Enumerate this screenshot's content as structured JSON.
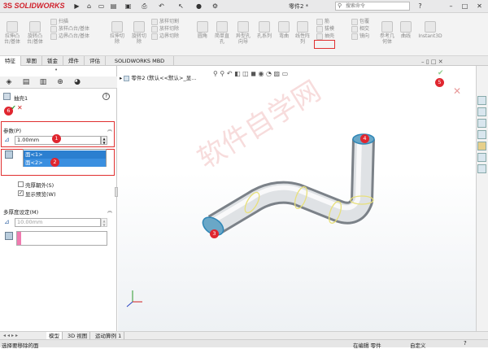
{
  "app": {
    "brand": "SOLIDWORKS",
    "brand_prefix": "3S",
    "doc_title": "零件2 *",
    "search_placeholder": "搜索命令"
  },
  "ribbon": {
    "large": [
      {
        "label": "拉伸凸\n台/基体"
      },
      {
        "label": "旋转凸\n台/基体"
      },
      {
        "label": "拉伸切\n除"
      },
      {
        "label": "旋转切\n除"
      },
      {
        "label": "圆角"
      },
      {
        "label": "简单直\n孔"
      },
      {
        "label": "异型孔\n向导"
      },
      {
        "label": "孔系列"
      },
      {
        "label": "弯曲"
      },
      {
        "label": "线性阵\n列"
      },
      {
        "label": "参考几\n何体"
      },
      {
        "label": "曲线"
      },
      {
        "label": "Instant3D"
      }
    ],
    "small": [
      "扫描",
      "放样凸台/基体",
      "边界凸台/基体",
      "放样切割",
      "放样切除",
      "边界切除",
      "筋",
      "拔模",
      "抽壳",
      "包覆",
      "相交",
      "镜向"
    ]
  },
  "tabs": [
    "特征",
    "草图",
    "钣金",
    "焊件",
    "评估",
    "SOLIDWORKS MBD"
  ],
  "panel": {
    "feature_name": "抽壳1",
    "help": "?",
    "ok": "✔",
    "cancel": "✕",
    "params_title": "参数(P)",
    "thickness": "1.00mm",
    "faces": [
      "面<1>",
      "面<2>"
    ],
    "shell_outward": "壳厚朝外(S)",
    "show_preview": "显示预览(W)",
    "multi_title": "多厚度设定(M)",
    "multi_thickness": "10.00mm"
  },
  "badges": [
    "1",
    "2",
    "3",
    "4",
    "5",
    "6"
  ],
  "viewport": {
    "tree_label": "零件2 (默认<<默认>_显..."
  },
  "watermark": "软件自学网",
  "bottom_tabs": [
    "模型",
    "3D 视图",
    "运动算例 1"
  ],
  "status": {
    "left": "选择要移除的面",
    "mid": "在编辑 零件",
    "right": "自定义"
  }
}
